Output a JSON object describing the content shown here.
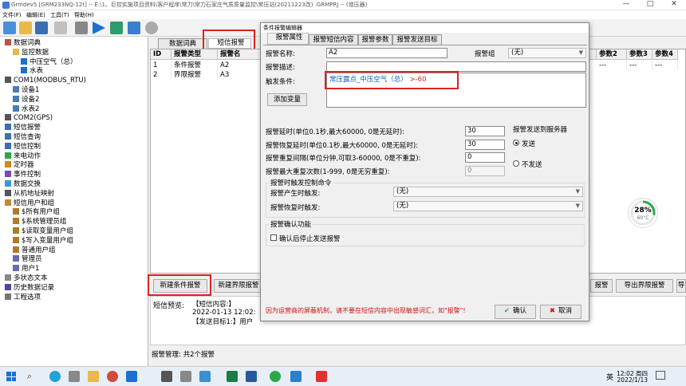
{
  "window": {
    "title": "Grmdev5 [GRM233NQ-12t] -- E:\\1、巨控实施项目资料\\客户程序\\常力\\常力石家庄气质质量监控\\常压站(20211223改) .GRMPRJ -- (增压器)",
    "min": "—",
    "max": "□",
    "close": "✕"
  },
  "menu": [
    "文件(F)",
    "编辑(E)",
    "工具(T)",
    "帮助(H)"
  ],
  "tree": [
    {
      "label": "数据词典",
      "level": 0,
      "icon": "db"
    },
    {
      "label": "监控数据",
      "level": 1,
      "icon": "folder"
    },
    {
      "label": "中压空气（总）",
      "level": 2,
      "icon": "item"
    },
    {
      "label": "水表",
      "level": 2,
      "icon": "item"
    },
    {
      "label": "COM1(MODBUS_RTU)",
      "level": 0,
      "icon": "com"
    },
    {
      "label": "设备1",
      "level": 1,
      "icon": "dev"
    },
    {
      "label": "设备2",
      "level": 1,
      "icon": "dev"
    },
    {
      "label": "水表2",
      "level": 1,
      "icon": "dev"
    },
    {
      "label": "COM2(GPS)",
      "level": 0,
      "icon": "com"
    },
    {
      "label": "短信报警",
      "level": 0,
      "icon": "sms"
    },
    {
      "label": "短信查询",
      "level": 0,
      "icon": "sms"
    },
    {
      "label": "短信控制",
      "level": 0,
      "icon": "sms"
    },
    {
      "label": "来电动作",
      "level": 0,
      "icon": "phone"
    },
    {
      "label": "定时器",
      "level": 0,
      "icon": "timer"
    },
    {
      "label": "事件控制",
      "level": 0,
      "icon": "event"
    },
    {
      "label": "数据交换",
      "level": 0,
      "icon": "swap"
    },
    {
      "label": "从机地址映射",
      "level": 0,
      "icon": "map"
    },
    {
      "label": "短信用户和组",
      "level": 0,
      "icon": "users"
    },
    {
      "label": "$所有用户组",
      "level": 1,
      "icon": "group"
    },
    {
      "label": "$系统管理员组",
      "level": 1,
      "icon": "group"
    },
    {
      "label": "$读取变量用户组",
      "level": 1,
      "icon": "group"
    },
    {
      "label": "$写入变量用户组",
      "level": 1,
      "icon": "group"
    },
    {
      "label": "普通用户组",
      "level": 1,
      "icon": "group"
    },
    {
      "label": "管理员",
      "level": 1,
      "icon": "user"
    },
    {
      "label": "用户1",
      "level": 1,
      "icon": "user"
    },
    {
      "label": "多状态文本",
      "level": 0,
      "icon": "text"
    },
    {
      "label": "历史数据记录",
      "level": 0,
      "icon": "hist"
    },
    {
      "label": "工程选项",
      "level": 0,
      "icon": "opt"
    }
  ],
  "tabs": {
    "dict": "数据词典",
    "sms_alarm": "短信报警"
  },
  "grid": {
    "headers": [
      "ID",
      "报警类型",
      "报警名"
    ],
    "rows": [
      [
        "1",
        "条件报警",
        "A2"
      ],
      [
        "2",
        "界限报警",
        "A3"
      ]
    ],
    "param_headers": [
      "参数2",
      "参数3",
      "参数4"
    ],
    "param_cells": [
      "---",
      "---",
      "---"
    ]
  },
  "buttons": {
    "new_cond": "新建条件报警",
    "new_limit": "新建界限报警",
    "right_partial": "报警",
    "export_limit": "导出界限报警",
    "far_right": "导"
  },
  "preview": {
    "label": "短信预览:",
    "line1": "【短信内容:】",
    "line2": "2022-01-13 12:02:",
    "line3": "【发送目标1:】用户"
  },
  "status": "报警管理: 共2个报警",
  "dialog": {
    "title": "条件报警编辑器",
    "tabs": [
      "报警属性",
      "报警短信内容",
      "报警参数",
      "报警发送目标"
    ],
    "name_label": "报警名称:",
    "name_value": "A2",
    "group_label": "报警组",
    "group_value": "(无)",
    "desc_label": "报警描述:",
    "desc_value": "",
    "cond_label": "触发条件:",
    "cond_var": "常压露点_中压空气（总）",
    "cond_op": " >-60",
    "add_var": "添加变量",
    "delay_label": "报警延时(单位0.1秒,最大60000, 0是无延时):",
    "delay_value": "30",
    "restore_label": "报警恢复延时(单位0.1秒,最大60000, 0是无延时):",
    "restore_value": "30",
    "repeat_label": "报警重复间隔(单位分钟,可取3-60000, 0是不重复):",
    "repeat_value": "0",
    "maxrep_label": "报警最大重复次数(1-999, 0是无穷重复):",
    "maxrep_value": "0",
    "server_label": "报警发送到服务器",
    "send": "发送",
    "nosend": "不发送",
    "trigger_group": "报警时触发控制命令",
    "gen_label": "报警产生时触发:",
    "gen_value": "(无)",
    "rec_label": "报警恢复时触发:",
    "rec_value": "(无)",
    "confirm_group": "报警确认功能",
    "confirm_check": "确认后停止发送报警",
    "warning": "因为运营商的屏蔽机制，请不要在短信内容中出现敏感词汇，如\"报警\"!",
    "ok": "确认",
    "cancel": "取消"
  },
  "gauge": {
    "percent": "28%",
    "temp": "60°C",
    "value": 0.28
  },
  "taskbar": {
    "time": "12:02 周四",
    "date": "2022/1/13",
    "lang": "英",
    "search_icon": "search-icon"
  },
  "colors": {
    "accent": "#1a5fb4",
    "red": "#e02020",
    "warn": "#d01010",
    "green": "#2aa84a"
  }
}
